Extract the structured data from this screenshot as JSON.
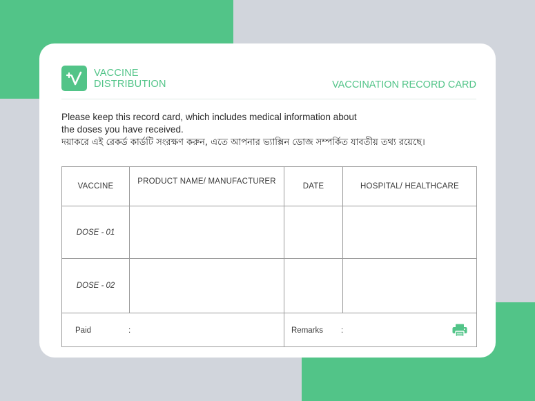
{
  "brand": {
    "line1": "VACCINE",
    "line2": "DISTRIBUTION"
  },
  "card": {
    "title": "VACCINATION RECORD CARD",
    "instructions_en_line1": "Please keep this record card, which includes medical information about",
    "instructions_en_line2": "the doses you have received.",
    "instructions_bn": "দয়াকরে এই রেকর্ড কার্ডটি সংরক্ষণ করুন, এতে আপনার ভ্যাক্সিন ডোজ সম্পর্কিত যাবতীয় তথ্য রয়েছে।"
  },
  "table": {
    "headers": [
      "VACCINE",
      "PRODUCT NAME/ MANUFACTURER",
      "DATE",
      "HOSPITAL/ HEALTHCARE"
    ],
    "rows": [
      {
        "dose": "DOSE - 01",
        "product": "",
        "date": "",
        "hospital": ""
      },
      {
        "dose": "DOSE - 02",
        "product": "",
        "date": "",
        "hospital": ""
      }
    ],
    "footer": {
      "paid_label": "Paid",
      "paid_sep": ":",
      "remarks_label": "Remarks",
      "remarks_sep": ":"
    }
  },
  "icons": {
    "logo": "vaccine-logo-icon",
    "print": "printer-icon"
  },
  "colors": {
    "accent": "#52c488",
    "background": "#d1d5dc",
    "card": "#ffffff",
    "border": "#9a9a9a"
  }
}
